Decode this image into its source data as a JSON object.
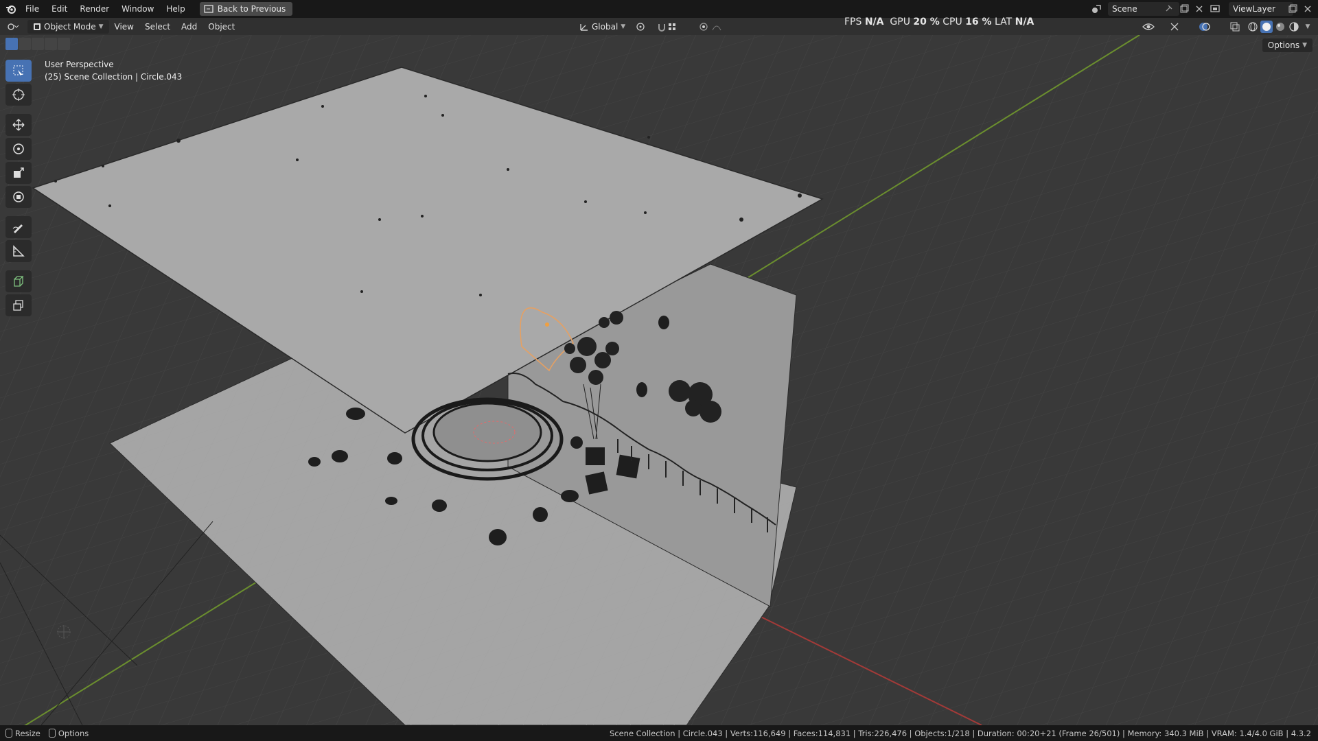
{
  "menu": [
    "File",
    "Edit",
    "Render",
    "Window",
    "Help"
  ],
  "back_button": "Back to Previous",
  "scene": "Scene",
  "view_layer": "ViewLayer",
  "header": {
    "mode": "Object Mode",
    "menus": [
      "View",
      "Select",
      "Add",
      "Object"
    ],
    "orientation": "Global"
  },
  "stats": {
    "fps_label": "FPS",
    "fps": "N/A",
    "gpu_label": "GPU",
    "gpu": "20 %",
    "cpu_label": "CPU",
    "cpu": "16 %",
    "lat_label": "LAT",
    "lat": "N/A"
  },
  "viewport": {
    "perspective": "User Perspective",
    "collection": "(25) Scene Collection | Circle.043",
    "options": "Options"
  },
  "tools": [
    "select-box-icon",
    "cursor-icon",
    "move-icon",
    "rotate-icon",
    "scale-icon",
    "transform-icon",
    "annotate-icon",
    "measure-icon",
    "add-cube-icon",
    "extrude-icon"
  ],
  "status": {
    "resize": "Resize",
    "options": "Options",
    "info": "Scene Collection | Circle.043 | Verts:116,649 | Faces:114,831 | Tris:226,476 | Objects:1/218 | Duration: 00:20+21 (Frame 26/501) | Memory: 340.3 MiB | VRAM: 1.4/4.0 GiB | 4.3.2"
  },
  "colors": {
    "accent": "#4772b3",
    "x_axis": "#c0392b",
    "y_axis": "#7fb33a",
    "selection": "#e8a060"
  }
}
